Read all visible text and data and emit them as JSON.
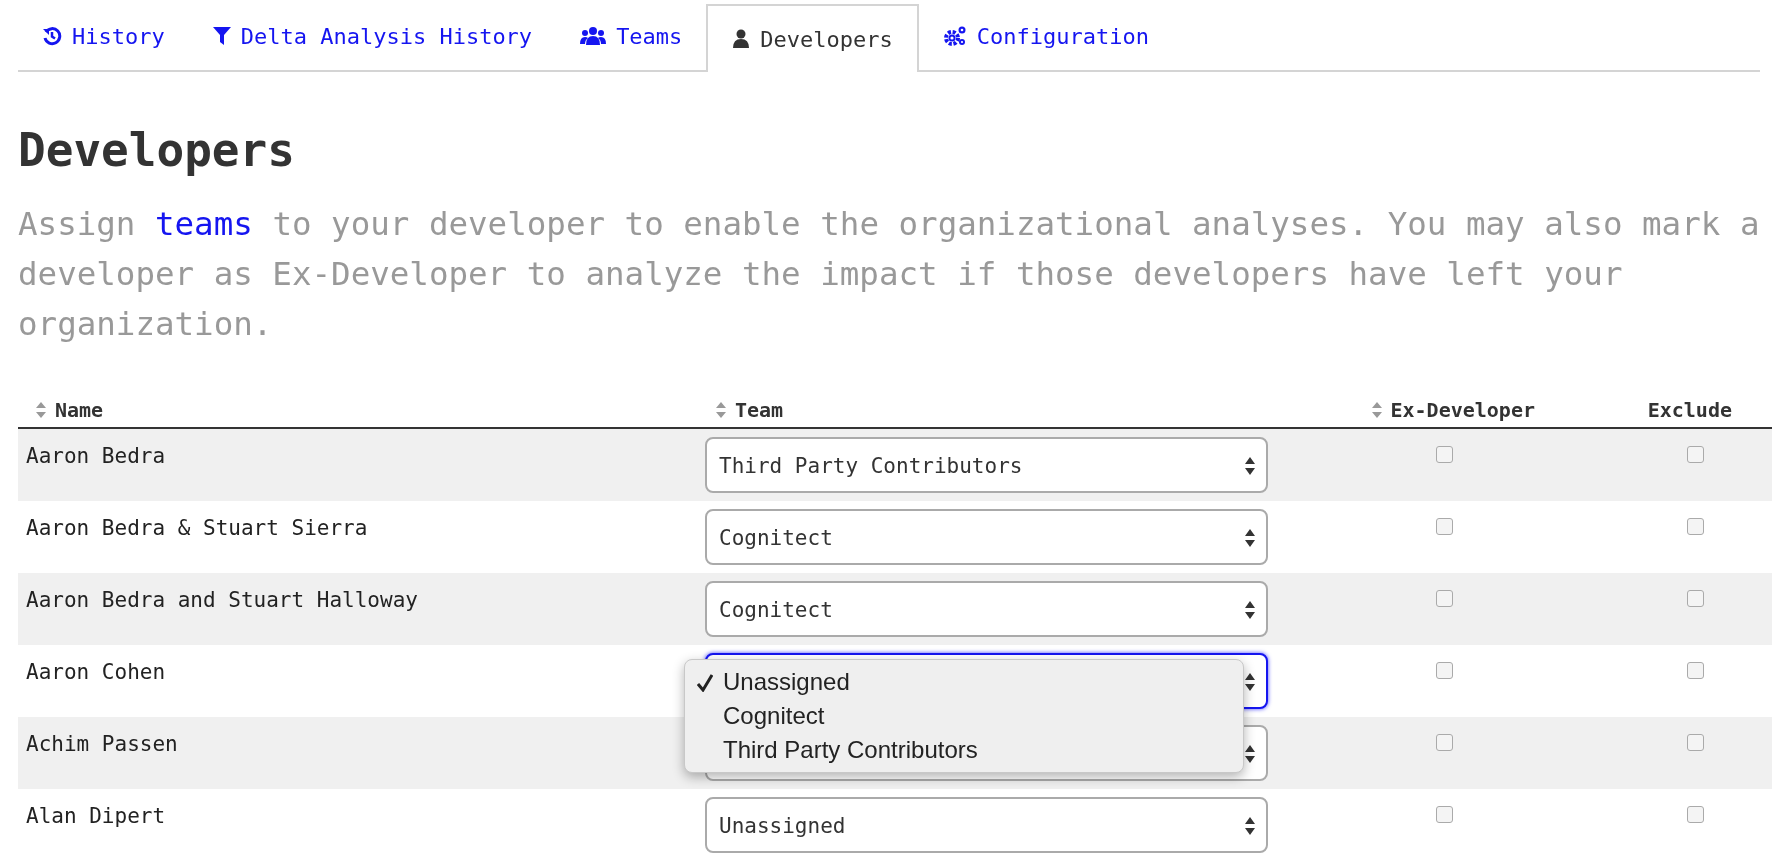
{
  "tabs": [
    {
      "label": "History",
      "selected": false
    },
    {
      "label": "Delta Analysis History",
      "selected": false
    },
    {
      "label": "Teams",
      "selected": false
    },
    {
      "label": "Developers",
      "selected": true
    },
    {
      "label": "Configuration",
      "selected": false
    }
  ],
  "page": {
    "title": "Developers",
    "description": {
      "before": "Assign",
      "link": "teams",
      "after": "to your developer to enable the organizational analyses. You may also mark a developer as Ex-Developer to analyze the impact if those developers have left your organization."
    }
  },
  "table": {
    "columns": [
      {
        "label": "Name",
        "sortable": true
      },
      {
        "label": "Team",
        "sortable": true
      },
      {
        "label": "Ex-Developer",
        "sortable": true
      },
      {
        "label": "Exclude",
        "sortable": false
      }
    ],
    "rows": [
      {
        "name": "Aaron Bedra",
        "team": "Third Party Contributors",
        "focused": false,
        "ex_developer": false,
        "exclude": false
      },
      {
        "name": "Aaron Bedra & Stuart Sierra",
        "team": "Cognitect",
        "focused": false,
        "ex_developer": false,
        "exclude": false
      },
      {
        "name": "Aaron Bedra and Stuart Halloway",
        "team": "Cognitect",
        "focused": false,
        "ex_developer": false,
        "exclude": false
      },
      {
        "name": "Aaron Cohen",
        "focused": true,
        "ex_developer": false,
        "exclude": false,
        "dropdown": {
          "options": [
            {
              "label": "Unassigned",
              "selected": true
            },
            {
              "label": "Cognitect",
              "selected": false
            },
            {
              "label": "Third Party Contributors",
              "selected": false
            }
          ]
        }
      },
      {
        "name": "Achim Passen",
        "focused": false,
        "ex_developer": false,
        "exclude": false
      },
      {
        "name": "Alan Dipert",
        "team": "Unassigned",
        "focused": false,
        "ex_developer": false,
        "exclude": false
      }
    ]
  }
}
